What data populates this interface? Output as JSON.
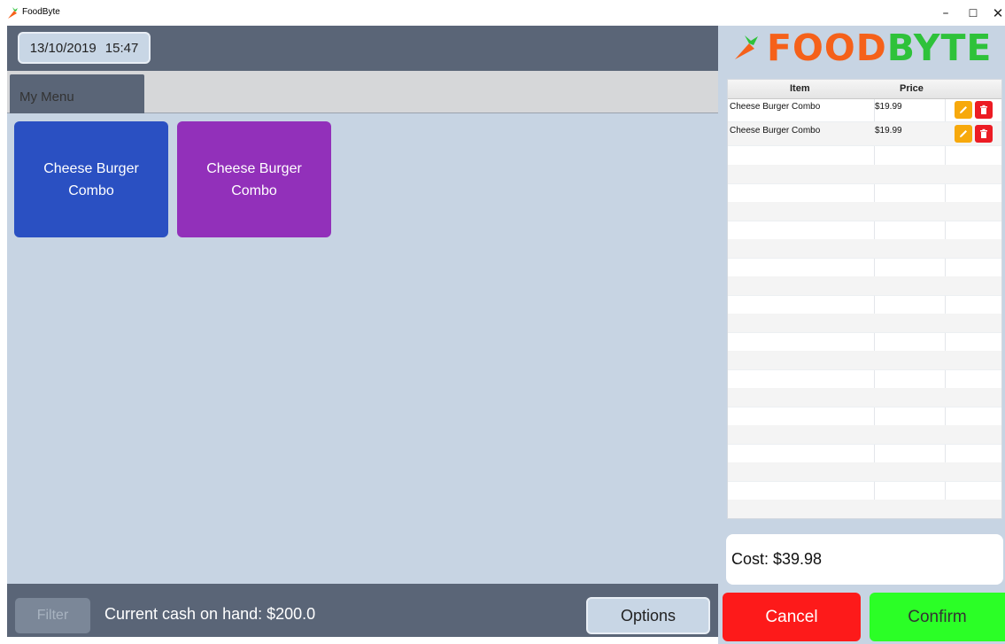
{
  "window": {
    "title": "FoodByte",
    "icon": "carrot-icon",
    "controls": {
      "minimize": "–",
      "maximize": "☐",
      "close": "✕"
    }
  },
  "header": {
    "date": "13/10/2019",
    "time": "15:47"
  },
  "tabs": [
    {
      "label": "My Menu",
      "selected": true
    }
  ],
  "menu": {
    "items": [
      {
        "line1": "Cheese Burger",
        "line2": "Combo",
        "color": "#2a50c2"
      },
      {
        "line1": "Cheese Burger",
        "line2": "Combo",
        "color": "#9230ba"
      }
    ]
  },
  "footer": {
    "filter_label": "Filter",
    "cash_label": "Current cash on hand: $200.0",
    "options_label": "Options"
  },
  "brand": {
    "food": "FOOD",
    "byte": "BYTE",
    "food_color": "#f5611a",
    "byte_color": "#2ec23a",
    "icon": "carrot-icon"
  },
  "order": {
    "columns": [
      "Item",
      "Price"
    ],
    "rows": [
      {
        "item": "Cheese Burger Combo",
        "price": "$19.99",
        "actions": [
          "pencil-icon",
          "trash-icon"
        ]
      },
      {
        "item": "Cheese Burger Combo",
        "price": "$19.99",
        "actions": [
          "pencil-icon",
          "trash-icon"
        ]
      }
    ],
    "cost_label": "Cost: $39.98"
  },
  "actions": {
    "cancel_label": "Cancel",
    "confirm_label": "Confirm",
    "cancel_color": "#fd1a1a",
    "confirm_color": "#2bff26"
  }
}
